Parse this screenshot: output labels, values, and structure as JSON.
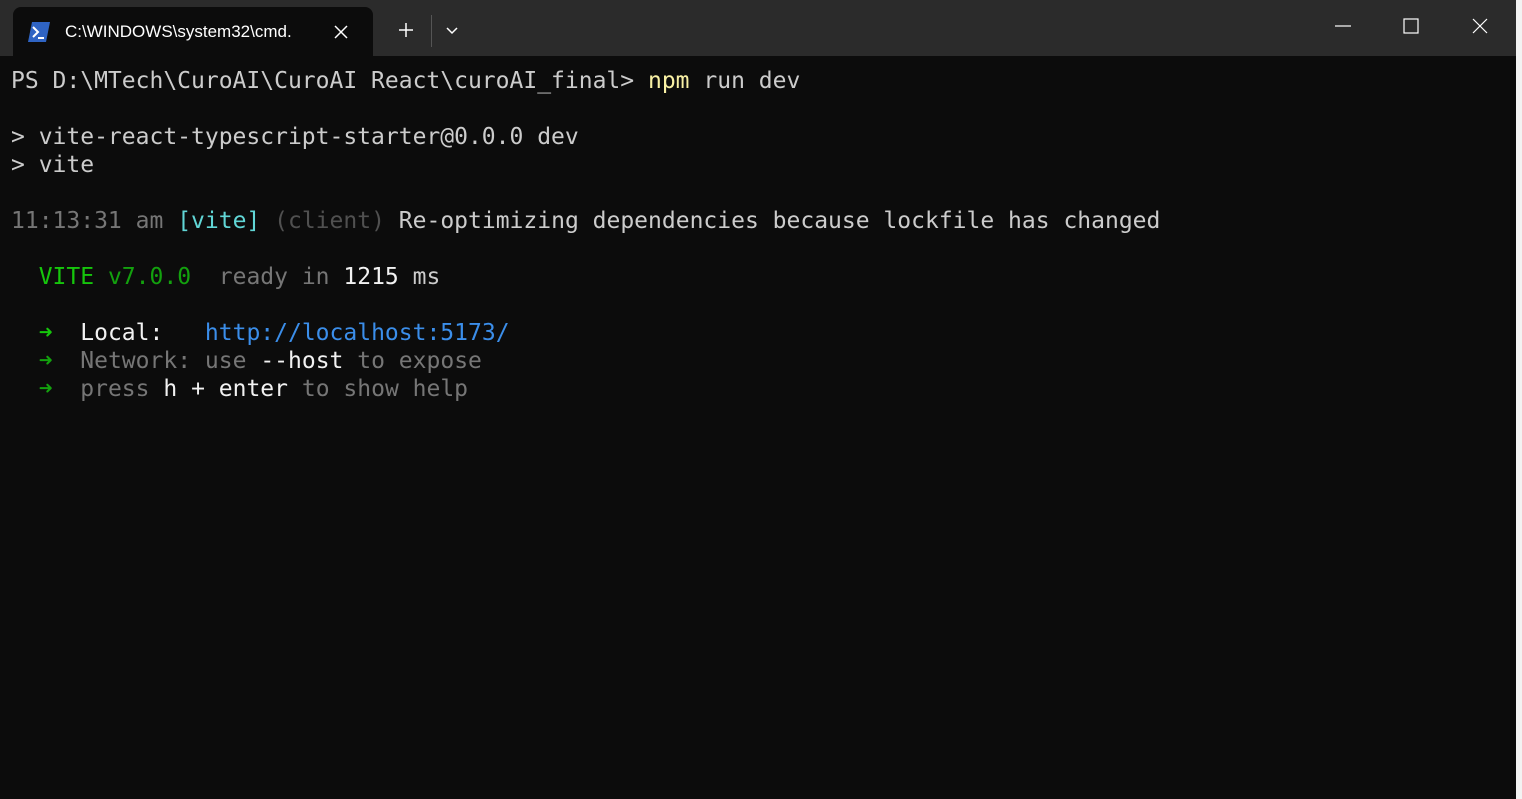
{
  "window": {
    "tab_title": "C:\\WINDOWS\\system32\\cmd.",
    "tab_icon": "powershell-icon",
    "new_tab_icon": "plus-icon",
    "dropdown_icon": "chevron-down-icon",
    "minimize_icon": "minimize-icon",
    "maximize_icon": "maximize-icon",
    "close_icon": "close-icon"
  },
  "terminal": {
    "prompt": "PS D:\\MTech\\CuroAI\\CuroAI React\\curoAI_final> ",
    "command_name": "npm",
    "command_args": " run dev",
    "script_line": "> vite-react-typescript-starter@0.0.0 dev",
    "script_cmd": "> vite",
    "log": {
      "time": "11:13:31 am",
      "tag": "[vite]",
      "scope": "(client)",
      "message": "Re-optimizing dependencies because lockfile has changed"
    },
    "ready": {
      "brand": "VITE",
      "version": "v7.0.0",
      "ready_text": "ready in",
      "duration": "1215",
      "unit": "ms"
    },
    "local": {
      "arrow": "➜",
      "label": "Local:",
      "url": "http://localhost:5173/"
    },
    "network": {
      "arrow": "➜",
      "label": "Network:",
      "pre": "use",
      "flag": "--host",
      "post": "to expose"
    },
    "help": {
      "arrow": "➜",
      "pre": "press",
      "keys": "h + enter",
      "post": "to show help"
    }
  },
  "colors": {
    "background": "#0c0c0c",
    "titlebar": "#2b2b2b",
    "foreground": "#cccccc",
    "yellow": "#f9f1a5",
    "cyan": "#61d6d6",
    "green": "#16c60c",
    "url_blue": "#3b8eea",
    "dim_gray": "#767676"
  }
}
